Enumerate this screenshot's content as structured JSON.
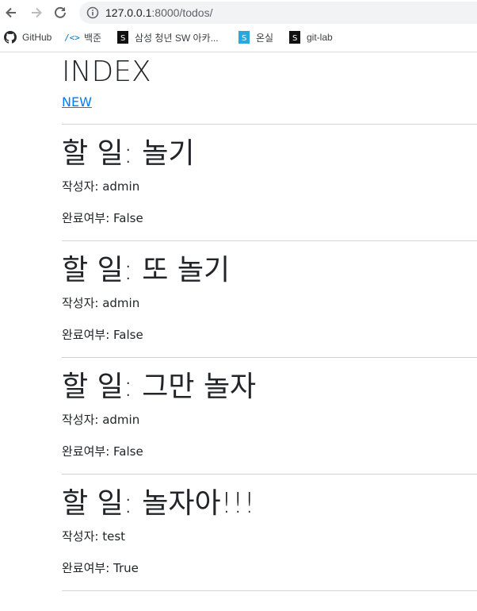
{
  "browser": {
    "url_host": "127.0.0.1",
    "url_port_path": ":8000/todos/",
    "bookmarks": [
      {
        "label": "GitHub",
        "icon": "github-icon"
      },
      {
        "label": "백준",
        "icon": "code-icon"
      },
      {
        "label": "삼성 청년 SW 아카...",
        "icon": "bookmark-s-icon"
      },
      {
        "label": "온실",
        "icon": "bookmark-s-icon"
      },
      {
        "label": "git-lab",
        "icon": "bookmark-s-icon"
      }
    ]
  },
  "page": {
    "title": "INDEX",
    "new_link": "NEW"
  },
  "todos": [
    {
      "title": "할 일: 놀기",
      "author": "작성자: admin",
      "completed": "완료여부: False"
    },
    {
      "title": "할 일: 또 놀기",
      "author": "작성자: admin",
      "completed": "완료여부: False"
    },
    {
      "title": "할 일: 그만 놀자",
      "author": "작성자: admin",
      "completed": "완료여부: False"
    },
    {
      "title": "할 일: 놀자아!!!",
      "author": "작성자: test",
      "completed": "완료여부: True"
    }
  ],
  "colors": {
    "link": "#007bff",
    "text": "#212529",
    "chrome_bg": "#f1f3f4"
  }
}
